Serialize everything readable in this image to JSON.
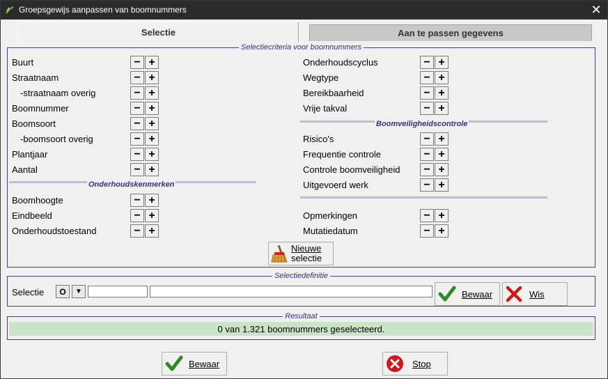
{
  "window": {
    "title": "Groepsgewijs aanpassen van boomnummers",
    "close_symbol": "✕"
  },
  "tabs": {
    "active": "Selectie",
    "inactive": "Aan te passen gegevens"
  },
  "criteria": {
    "legend": "Selectiecriteria voor boomnummers",
    "left_rows": [
      "Buurt",
      "Straatnaam",
      "-straatnaam overig",
      "Boomnummer",
      "Boomsoort",
      "-boomsoort overig",
      "Plantjaar",
      "Aantal"
    ],
    "maintenance_title": "Onderhoudskenmerken",
    "maintenance_rows": [
      "Boomhoogte",
      "Eindbeeld",
      "Onderhoudstoestand"
    ],
    "right_rows": [
      "Onderhoudscyclus",
      "Wegtype",
      "Bereikbaarheid",
      "Vrije takval"
    ],
    "safety_title": "Boomveiligheidscontrole",
    "safety_rows": [
      "Risico's",
      "Frequentie controle",
      "Controle boomveiligheid",
      "Uitgevoerd werk"
    ],
    "extra_rows": [
      "Opmerkingen",
      "Mutatiedatum"
    ],
    "minus_symbol": "−",
    "plus_symbol": "+",
    "new_selection_line1": "Nieuwe",
    "new_selection_line2": "selectie"
  },
  "definition": {
    "legend": "Selectiedefinitie",
    "label": "Selectie",
    "open_symbol": "O",
    "dropdown_symbol": "▼",
    "code_value": "",
    "description_value": "",
    "save_label": "Bewaar",
    "clear_label": "Wis"
  },
  "result": {
    "legend": "Resultaat",
    "text": "0 van 1.321 boomnummers geselecteerd."
  },
  "footer": {
    "save_label": "Bewaar",
    "stop_label": "Stop"
  },
  "colors": {
    "accent": "#3c2f7a",
    "result_bg": "#c9e4c7",
    "check_green": "#2e8b23",
    "cross_red": "#d01818"
  }
}
